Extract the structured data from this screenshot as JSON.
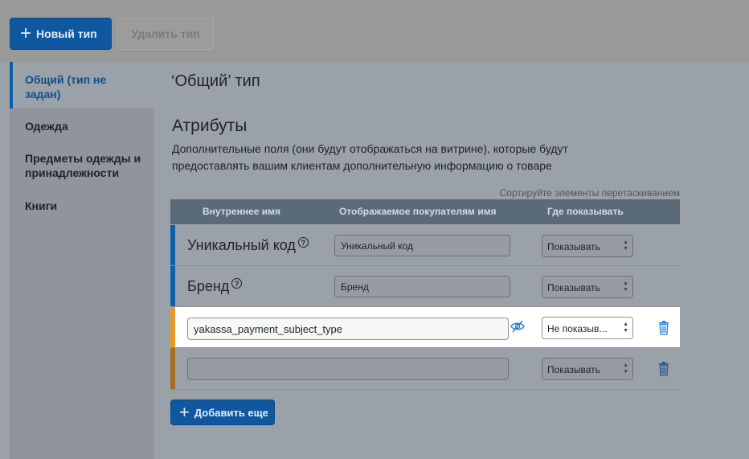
{
  "toolbar": {
    "new_type_label": "Новый тип",
    "delete_type_label": "Удалить тип"
  },
  "sidebar": {
    "items": [
      {
        "label": "Общий (тип не задан)",
        "active": true
      },
      {
        "label": "Одежда"
      },
      {
        "label": "Предметы одежды и принадлежности"
      },
      {
        "label": "Книги"
      }
    ]
  },
  "main": {
    "title": "‘Общий’ тип",
    "attributes_title": "Атрибуты",
    "attributes_desc": "Дополнительные поля (они будут отображаться на витрине), которые будут предоставлять вашим клиентам дополнительную информацию о товаре",
    "sort_hint": "Сортируйте элементы перетаскиванием"
  },
  "table": {
    "headers": {
      "internal_name": "Внутреннее имя",
      "display_name": "Отображаемое покупателям имя",
      "where_show": "Где показывать"
    },
    "rows": [
      {
        "name": "Уникальный код",
        "display": "Уникальный код",
        "show": "Показывать",
        "help": "?"
      },
      {
        "name": "Бренд",
        "display": "Бренд",
        "show": "Показывать",
        "help": "?"
      },
      {
        "internal_value": "yakassa_payment_subject_type",
        "show": "Не показыв..."
      },
      {
        "internal_value": "",
        "show": "Показывать"
      }
    ]
  },
  "add_more_label": "Добавить еще",
  "colors": {
    "accent": "#0f58a0",
    "row_bar_blue": "#0f5fa8",
    "row_bar_orange": "#e39b25",
    "row_bar_brown": "#a36d22"
  }
}
